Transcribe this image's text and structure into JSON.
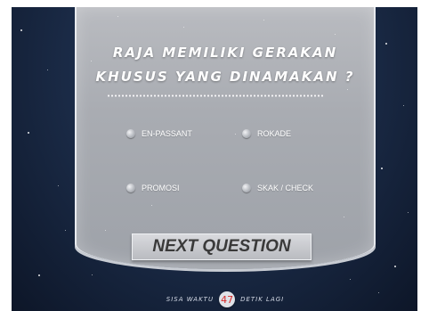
{
  "quiz": {
    "question_line1": "RAJA MEMILIKI GERAKAN",
    "question_line2": "KHUSUS YANG DINAMAKAN ?",
    "options": [
      {
        "label": "EN-PASSANT",
        "selected": false
      },
      {
        "label": "ROKADE",
        "selected": false
      },
      {
        "label": "PROMOSI",
        "selected": false
      },
      {
        "label": "SKAK / CHECK",
        "selected": false
      }
    ],
    "next_label": "NEXT QUESTION"
  },
  "timer": {
    "prefix": "SISA WAKTU",
    "seconds": "47",
    "suffix": "DETIK LAGI"
  },
  "colors": {
    "panel": "#a9acb2",
    "background": "#1c2d4a",
    "timer_number": "#d42a2a"
  },
  "icons": {
    "option_marker": "radio-button"
  }
}
